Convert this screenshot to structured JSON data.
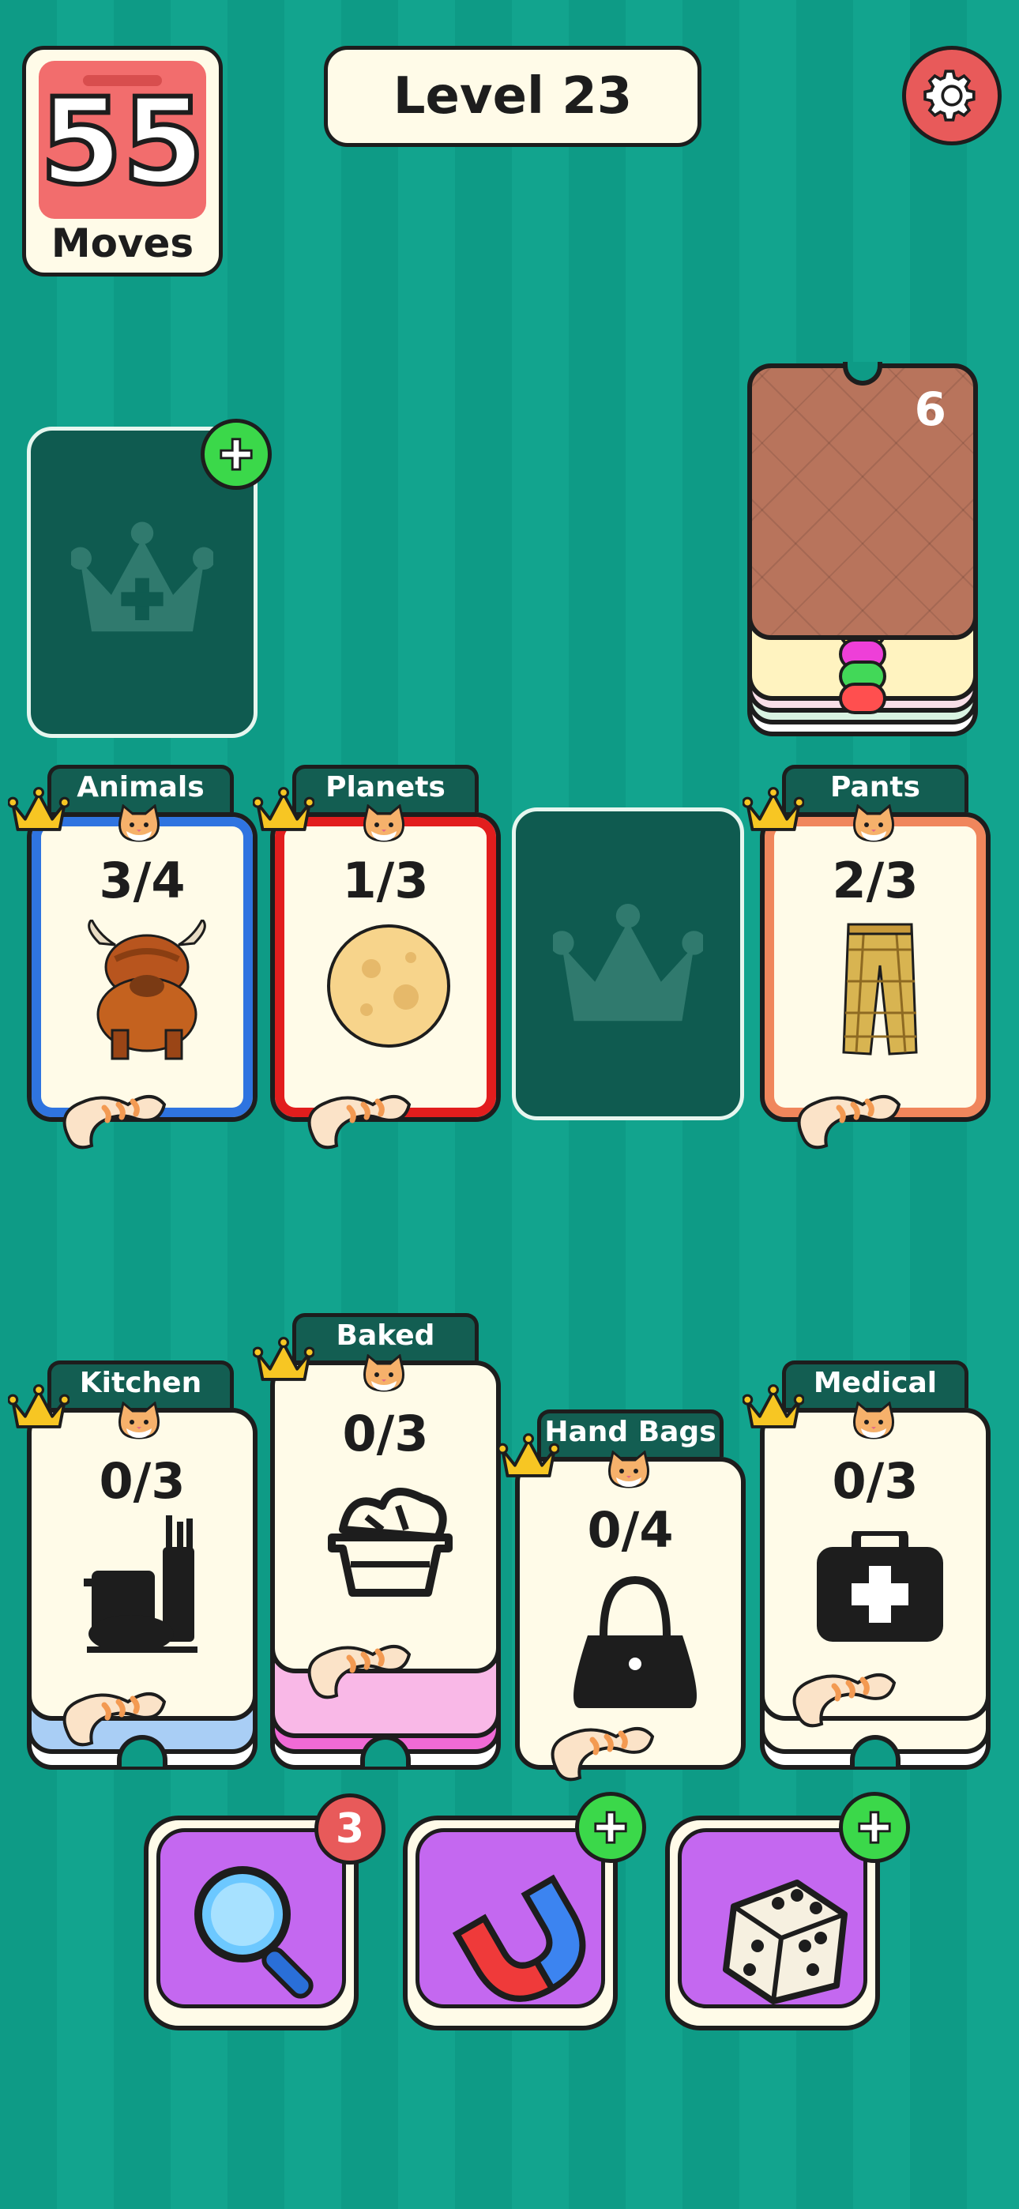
{
  "header": {
    "moves_count": "55",
    "moves_label": "Moves",
    "level_label": "Level 23"
  },
  "deck": {
    "remaining": "6"
  },
  "row1": [
    {
      "category": "Animals",
      "progress": "3/4",
      "border_color": "#2f74e0",
      "icon": "highland-cow-icon"
    },
    {
      "category": "Planets",
      "progress": "1/3",
      "border_color": "#e21d1d",
      "icon": "moon-icon"
    },
    {
      "category": "Pants",
      "progress": "2/3",
      "border_color": "#f0865c",
      "icon": "plaid-pants-icon"
    }
  ],
  "row2": [
    {
      "category": "Kitchen",
      "progress": "0/3",
      "icon": "kitchen-utensils-icon"
    },
    {
      "category": "Baked",
      "progress": "0/3",
      "icon": "bread-basket-icon"
    },
    {
      "category": "Hand Bags",
      "progress": "0/4",
      "icon": "handbag-icon"
    },
    {
      "category": "Medical",
      "progress": "0/3",
      "icon": "medical-kit-icon"
    }
  ],
  "boosters": [
    {
      "name": "magnifier",
      "badge": "3",
      "icon": "magnifier-icon"
    },
    {
      "name": "magnet",
      "badge": "+",
      "icon": "magnet-icon"
    },
    {
      "name": "dice",
      "badge": "+",
      "icon": "dice-icon"
    }
  ],
  "colors": {
    "background": "#0e9b86",
    "slot": "#0f5b50",
    "booster": "#c468f0",
    "badge_red": "#e85a5a",
    "badge_green": "#3bd84a"
  }
}
